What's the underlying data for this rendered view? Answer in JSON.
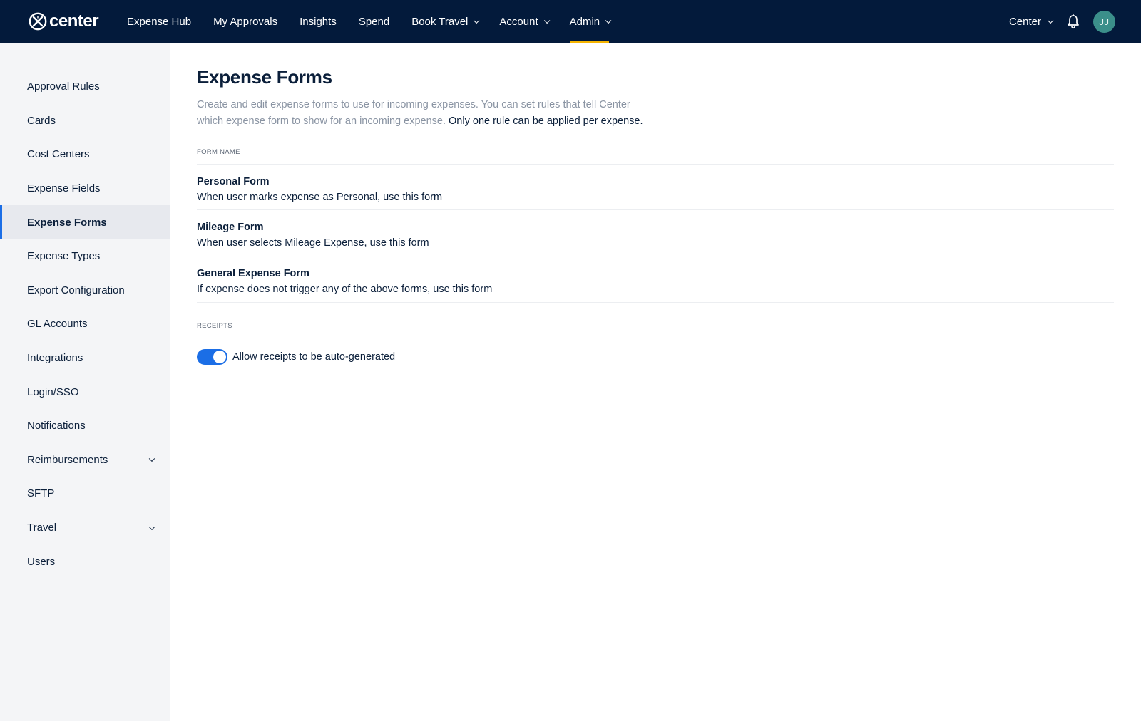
{
  "brand": {
    "name": "center"
  },
  "nav": {
    "items": [
      {
        "label": "Expense Hub",
        "has_menu": false,
        "active": false
      },
      {
        "label": "My Approvals",
        "has_menu": false,
        "active": false
      },
      {
        "label": "Insights",
        "has_menu": false,
        "active": false
      },
      {
        "label": "Spend",
        "has_menu": false,
        "active": false
      },
      {
        "label": "Book Travel",
        "has_menu": true,
        "active": false
      },
      {
        "label": "Account",
        "has_menu": true,
        "active": false
      },
      {
        "label": "Admin",
        "has_menu": true,
        "active": true
      }
    ],
    "org_label": "Center",
    "avatar_initials": "JJ"
  },
  "sidebar": {
    "items": [
      {
        "label": "Approval Rules"
      },
      {
        "label": "Cards"
      },
      {
        "label": "Cost Centers"
      },
      {
        "label": "Expense Fields"
      },
      {
        "label": "Expense Forms",
        "active": true
      },
      {
        "label": "Expense Types"
      },
      {
        "label": "Export Configuration"
      },
      {
        "label": "GL Accounts"
      },
      {
        "label": "Integrations"
      },
      {
        "label": "Login/SSO"
      },
      {
        "label": "Notifications"
      },
      {
        "label": "Reimbursements",
        "expandable": true
      },
      {
        "label": "SFTP"
      },
      {
        "label": "Travel",
        "expandable": true
      },
      {
        "label": "Users"
      }
    ]
  },
  "main": {
    "title": "Expense Forms",
    "description": "Create and edit expense forms to use for incoming expenses. You can set rules that tell Center which expense form to show for an incoming expense. ",
    "description_emphasis": "Only one rule can be applied per expense.",
    "forms_header": "FORM NAME",
    "forms": [
      {
        "name": "Personal Form",
        "rule": "When user marks expense as Personal, use this form"
      },
      {
        "name": "Mileage Form",
        "rule": "When user selects Mileage Expense, use this form"
      },
      {
        "name": "General Expense Form",
        "rule": "If expense does not trigger any of the above forms, use this form"
      }
    ],
    "receipts_header": "RECEIPTS",
    "receipts_toggle_label": "Allow receipts to be auto-generated",
    "receipts_toggle_on": true
  },
  "colors": {
    "topbar": "#031a3b",
    "accent_underline": "#f5b400",
    "toggle_on": "#1b6ee6",
    "avatar": "#3b8f8a",
    "sidebar_bg": "#f4f5f7"
  }
}
